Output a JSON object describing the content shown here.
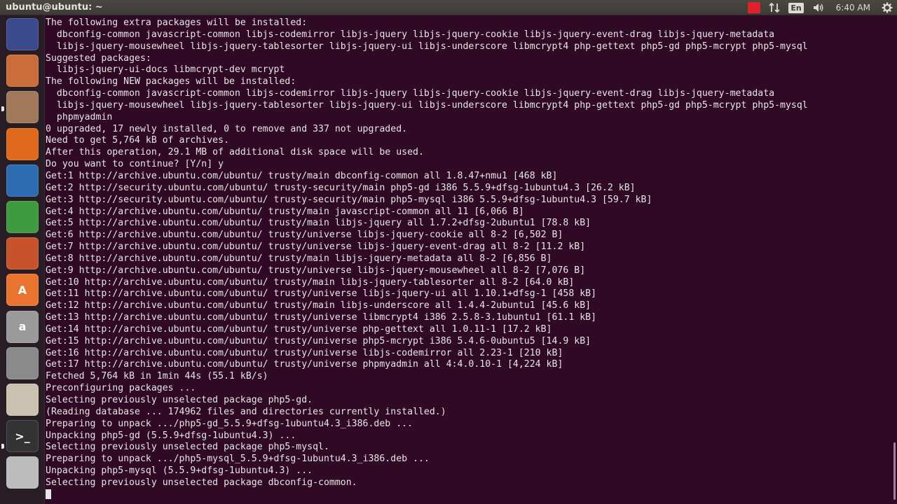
{
  "topbar": {
    "title": "ubuntu@ubuntu: ~",
    "language": "En",
    "clock": "6:40 AM",
    "icons": [
      "network-icon",
      "keyboard-layout-icon",
      "sound-icon",
      "settings-gear-icon"
    ]
  },
  "launcher": {
    "items": [
      {
        "name": "dash-home",
        "label": "",
        "color": "#3b4a8a"
      },
      {
        "name": "files-app",
        "label": "",
        "color": "#c96d3a"
      },
      {
        "name": "file-manager",
        "label": "",
        "color": "#a0795a"
      },
      {
        "name": "firefox",
        "label": "",
        "color": "#e06a1b"
      },
      {
        "name": "writer",
        "label": "",
        "color": "#2b6cb0"
      },
      {
        "name": "calc",
        "label": "",
        "color": "#3e9a3e"
      },
      {
        "name": "impress",
        "label": "",
        "color": "#c7532a"
      },
      {
        "name": "software-center",
        "label": "A",
        "color": "#e8742f"
      },
      {
        "name": "amazon",
        "label": "a",
        "color": "#9a9a9a"
      },
      {
        "name": "system-settings",
        "label": "",
        "color": "#8a8a8a"
      },
      {
        "name": "text-editor",
        "label": "",
        "color": "#c9c2b0"
      },
      {
        "name": "terminal",
        "label": ">_",
        "color": "#333333"
      },
      {
        "name": "printer",
        "label": "",
        "color": "#bcbcbc"
      }
    ]
  },
  "terminal": {
    "lines": [
      "The following extra packages will be installed:",
      "  dbconfig-common javascript-common libjs-codemirror libjs-jquery libjs-jquery-cookie libjs-jquery-event-drag libjs-jquery-metadata",
      "  libjs-jquery-mousewheel libjs-jquery-tablesorter libjs-jquery-ui libjs-underscore libmcrypt4 php-gettext php5-gd php5-mcrypt php5-mysql",
      "Suggested packages:",
      "  libjs-jquery-ui-docs libmcrypt-dev mcrypt",
      "The following NEW packages will be installed:",
      "  dbconfig-common javascript-common libjs-codemirror libjs-jquery libjs-jquery-cookie libjs-jquery-event-drag libjs-jquery-metadata",
      "  libjs-jquery-mousewheel libjs-jquery-tablesorter libjs-jquery-ui libjs-underscore libmcrypt4 php-gettext php5-gd php5-mcrypt php5-mysql",
      "  phpmyadmin",
      "0 upgraded, 17 newly installed, 0 to remove and 337 not upgraded.",
      "Need to get 5,764 kB of archives.",
      "After this operation, 29.1 MB of additional disk space will be used.",
      "Do you want to continue? [Y/n] y",
      "Get:1 http://archive.ubuntu.com/ubuntu/ trusty/main dbconfig-common all 1.8.47+nmu1 [468 kB]",
      "Get:2 http://security.ubuntu.com/ubuntu/ trusty-security/main php5-gd i386 5.5.9+dfsg-1ubuntu4.3 [26.2 kB]",
      "Get:3 http://security.ubuntu.com/ubuntu/ trusty-security/main php5-mysql i386 5.5.9+dfsg-1ubuntu4.3 [59.7 kB]",
      "Get:4 http://archive.ubuntu.com/ubuntu/ trusty/main javascript-common all 11 [6,066 B]",
      "Get:5 http://archive.ubuntu.com/ubuntu/ trusty/main libjs-jquery all 1.7.2+dfsg-2ubuntu1 [78.8 kB]",
      "Get:6 http://archive.ubuntu.com/ubuntu/ trusty/universe libjs-jquery-cookie all 8-2 [6,502 B]",
      "Get:7 http://archive.ubuntu.com/ubuntu/ trusty/universe libjs-jquery-event-drag all 8-2 [11.2 kB]",
      "Get:8 http://archive.ubuntu.com/ubuntu/ trusty/main libjs-jquery-metadata all 8-2 [6,856 B]",
      "Get:9 http://archive.ubuntu.com/ubuntu/ trusty/universe libjs-jquery-mousewheel all 8-2 [7,076 B]",
      "Get:10 http://archive.ubuntu.com/ubuntu/ trusty/main libjs-jquery-tablesorter all 8-2 [64.0 kB]",
      "Get:11 http://archive.ubuntu.com/ubuntu/ trusty/universe libjs-jquery-ui all 1.10.1+dfsg-1 [458 kB]",
      "Get:12 http://archive.ubuntu.com/ubuntu/ trusty/main libjs-underscore all 1.4.4-2ubuntu1 [45.6 kB]",
      "Get:13 http://archive.ubuntu.com/ubuntu/ trusty/universe libmcrypt4 i386 2.5.8-3.1ubuntu1 [61.1 kB]",
      "Get:14 http://archive.ubuntu.com/ubuntu/ trusty/universe php-gettext all 1.0.11-1 [17.2 kB]",
      "Get:15 http://archive.ubuntu.com/ubuntu/ trusty/universe php5-mcrypt i386 5.4.6-0ubuntu5 [14.9 kB]",
      "Get:16 http://archive.ubuntu.com/ubuntu/ trusty/universe libjs-codemirror all 2.23-1 [210 kB]",
      "Get:17 http://archive.ubuntu.com/ubuntu/ trusty/universe phpmyadmin all 4:4.0.10-1 [4,224 kB]",
      "Fetched 5,764 kB in 1min 44s (55.1 kB/s)",
      "Preconfiguring packages ...",
      "Selecting previously unselected package php5-gd.",
      "(Reading database ... 174962 files and directories currently installed.)",
      "Preparing to unpack .../php5-gd_5.5.9+dfsg-1ubuntu4.3_i386.deb ...",
      "Unpacking php5-gd (5.5.9+dfsg-1ubuntu4.3) ...",
      "Selecting previously unselected package php5-mysql.",
      "Preparing to unpack .../php5-mysql_5.5.9+dfsg-1ubuntu4.3_i386.deb ...",
      "Unpacking php5-mysql (5.5.9+dfsg-1ubuntu4.3) ...",
      "Selecting previously unselected package dbconfig-common."
    ]
  }
}
